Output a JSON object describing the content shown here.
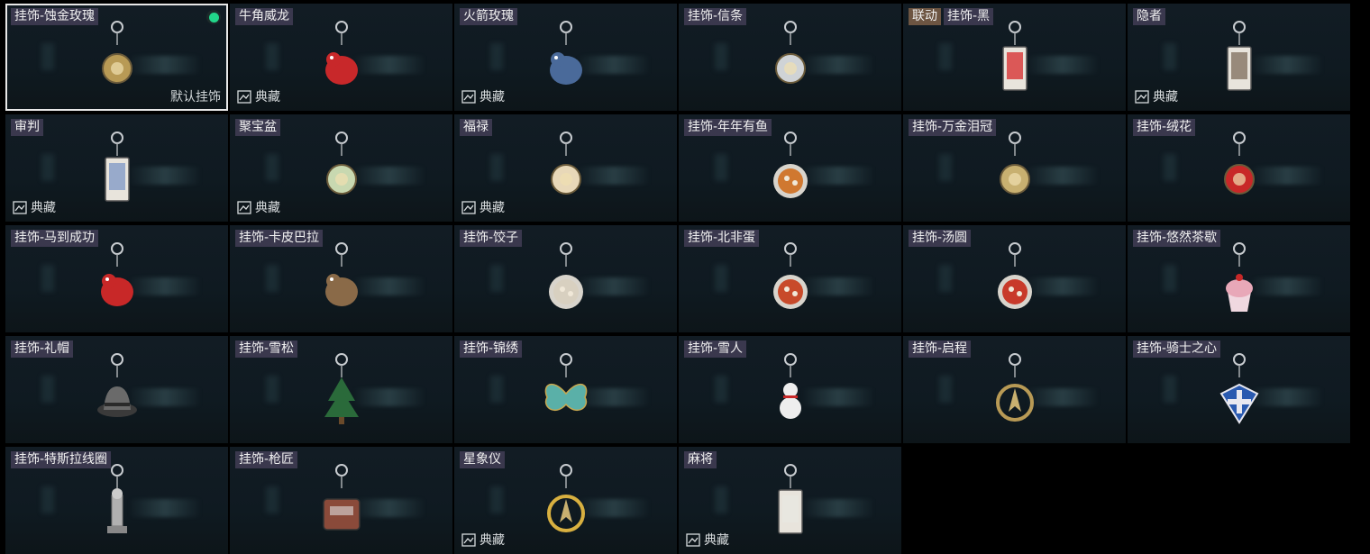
{
  "items": [
    {
      "name": "挂饰-蚀金玫瑰",
      "selected": true,
      "default_label": "默认挂饰",
      "collection": "",
      "charm": "gold-rose-icon",
      "color": "#b89a55"
    },
    {
      "name": "牛角威龙",
      "collection": "典藏",
      "charm": "horned-dragon-icon",
      "color": "#c8282a"
    },
    {
      "name": "火箭玫瑰",
      "collection": "典藏",
      "charm": "rocket-rose-icon",
      "color": "#4a6a9a"
    },
    {
      "name": "挂饰-信条",
      "collection": "",
      "charm": "creed-icon",
      "color": "#cfd3d6"
    },
    {
      "name": "挂饰-黑",
      "collab": "联动",
      "collection": "",
      "charm": "black-card-icon",
      "color": "#d84040"
    },
    {
      "name": "隐者",
      "collection": "典藏",
      "charm": "hermit-card-icon",
      "color": "#8a7a6a"
    },
    {
      "name": "审判",
      "collection": "典藏",
      "charm": "judgment-card-icon",
      "color": "#8aa0c8"
    },
    {
      "name": "聚宝盆",
      "collection": "典藏",
      "charm": "treasure-bowl-icon",
      "color": "#c8d8b0"
    },
    {
      "name": "福禄",
      "collection": "典藏",
      "charm": "gourd-icon",
      "color": "#e8d8b8"
    },
    {
      "name": "挂饰-年年有鱼",
      "collection": "",
      "charm": "fish-icon",
      "color": "#d07830"
    },
    {
      "name": "挂饰-万金泪冠",
      "collection": "",
      "charm": "gold-crown-icon",
      "color": "#c8b070"
    },
    {
      "name": "挂饰-绒花",
      "collection": "",
      "charm": "velvet-flower-icon",
      "color": "#c82828"
    },
    {
      "name": "挂饰-马到成功",
      "collection": "",
      "charm": "horse-icon",
      "color": "#c82828"
    },
    {
      "name": "挂饰-卡皮巴拉",
      "collection": "",
      "charm": "capybara-icon",
      "color": "#8a6a48"
    },
    {
      "name": "挂饰-饺子",
      "collection": "",
      "charm": "dumpling-icon",
      "color": "#d8d0c0"
    },
    {
      "name": "挂饰-北非蛋",
      "collection": "",
      "charm": "shakshuka-icon",
      "color": "#c84a2a"
    },
    {
      "name": "挂饰-汤圆",
      "collection": "",
      "charm": "tangyuan-icon",
      "color": "#c83a2a"
    },
    {
      "name": "挂饰-悠然茶歇",
      "collection": "",
      "charm": "cupcake-icon",
      "color": "#e8a8b8"
    },
    {
      "name": "挂饰-礼帽",
      "collection": "",
      "charm": "hat-icon",
      "color": "#6a6a6a"
    },
    {
      "name": "挂饰-雪松",
      "collection": "",
      "charm": "pine-tree-icon",
      "color": "#2a6a3a"
    },
    {
      "name": "挂饰-锦绣",
      "collection": "",
      "charm": "butterfly-icon",
      "color": "#5ab0a8"
    },
    {
      "name": "挂饰-雪人",
      "collection": "",
      "charm": "snowman-icon",
      "color": "#e8e8e8"
    },
    {
      "name": "挂饰-启程",
      "collection": "",
      "charm": "compass-icon",
      "color": "#b89a55"
    },
    {
      "name": "挂饰-骑士之心",
      "collection": "",
      "charm": "knight-badge-icon",
      "color": "#2a5ab0"
    },
    {
      "name": "挂饰-特斯拉线圈",
      "collection": "",
      "charm": "tesla-coil-icon",
      "color": "#b0b0b0"
    },
    {
      "name": "挂饰-枪匠",
      "collection": "",
      "charm": "gunsmith-case-icon",
      "color": "#8a4a3a"
    },
    {
      "name": "星象仪",
      "collection": "典藏",
      "charm": "astrolabe-icon",
      "color": "#d8b040"
    },
    {
      "name": "麻将",
      "collection": "典藏",
      "charm": "mahjong-tile-icon",
      "color": "#e8e8e0"
    }
  ]
}
